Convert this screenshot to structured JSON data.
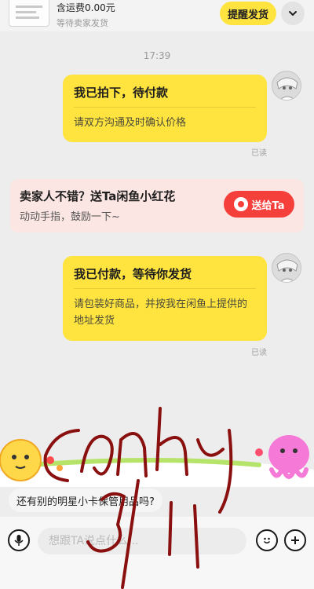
{
  "order": {
    "price_text": "含运费0.00元",
    "status_text": "等待卖家发货",
    "remind_button": "提醒发货",
    "expand_icon": "chevron-down-icon"
  },
  "chat": {
    "timestamp": "17:39",
    "messages": [
      {
        "title": "我已拍下，待付款",
        "body": "请双方沟通及时确认价格",
        "read_status": "已读"
      },
      {
        "title": "我已付款，等待你发货",
        "body": "请包装好商品，并按我在闲鱼上提供的地址发货",
        "read_status": "已读"
      }
    ],
    "flower_card": {
      "title": "卖家人不错？送Ta闲鱼小红花",
      "subtitle": "动动手指，鼓励一下~",
      "button": "送给Ta",
      "accent": "#f43f3a"
    }
  },
  "suggestion": "还有别的明星小卡保管用品吗?",
  "input_bar": {
    "placeholder": "想跟TA说点什么...",
    "voice_icon": "microphone-icon",
    "emoji_icon": "emoji-icon",
    "add_icon": "plus-icon"
  },
  "colors": {
    "bubble": "#ffe33f",
    "background": "#ededed",
    "handwriting": "#8a1010"
  }
}
